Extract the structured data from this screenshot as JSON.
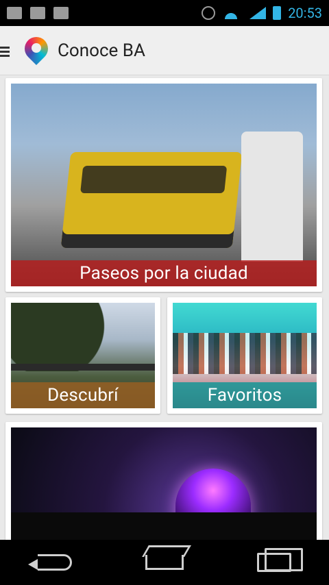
{
  "status_bar": {
    "time": "20:53",
    "network_type": "2G"
  },
  "action_bar": {
    "title": "Conoce BA"
  },
  "cards": [
    {
      "id": "paseos",
      "label": "Paseos por la ciudad",
      "accent": "#b41e1e"
    },
    {
      "id": "descubri",
      "label": "Descubrí",
      "accent": "#965f23"
    },
    {
      "id": "favoritos",
      "label": "Favoritos",
      "accent": "#149696"
    },
    {
      "id": "planetario",
      "label": ""
    }
  ],
  "icons": {
    "menu": "menu-icon",
    "logo": "location-pin-logo-icon",
    "back": "back-icon",
    "home": "home-icon",
    "recent": "recent-apps-icon"
  },
  "colors": {
    "status_blue": "#33b5e5",
    "background": "#e9e9e9",
    "action_bar": "#efefef"
  }
}
